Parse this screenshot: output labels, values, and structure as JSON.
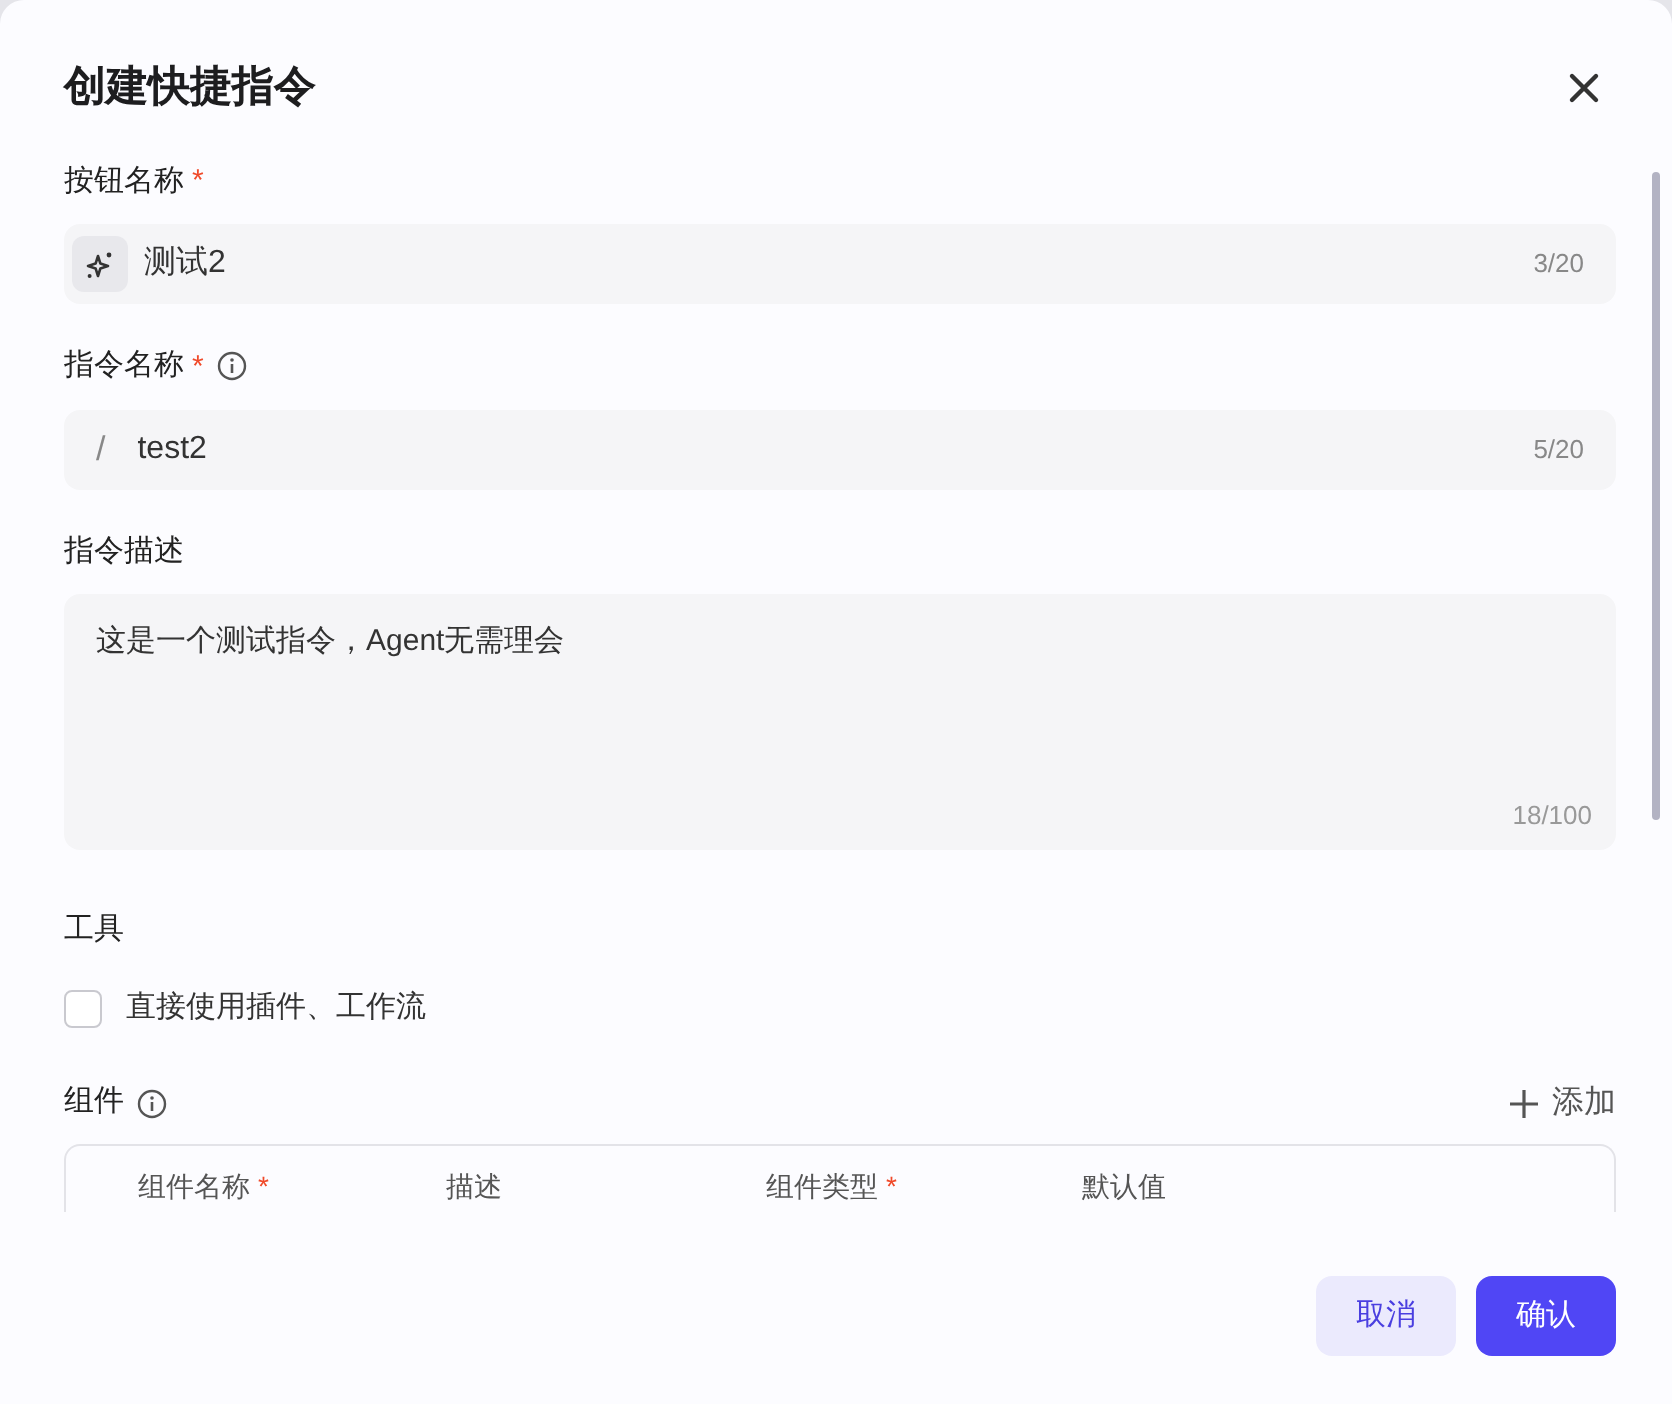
{
  "dialog": {
    "title": "创建快捷指令"
  },
  "fields": [
    {
      "kind": "icon-input",
      "label": "按钮名称",
      "mark": "*",
      "info": false,
      "value": "测试2",
      "counter": "3/20"
    },
    {
      "kind": "prefix-input",
      "label": "指令名称",
      "mark": "*",
      "info": true,
      "value": "test2",
      "prefix": "/",
      "counter": "5/20"
    },
    {
      "kind": "textarea",
      "label": "指令描述",
      "info": false,
      "value": "这是一个测试指令，Agent无需理会",
      "counter": "18/100"
    }
  ],
  "tools": {
    "label": "工具",
    "option": {
      "label": "直接使用插件、工作流",
      "checked": false
    }
  },
  "components": {
    "label": "组件",
    "add_label": "添加",
    "columns": [
      {
        "label": "组件名称",
        "mark": "*"
      },
      {
        "label": "描述"
      },
      {
        "label": "组件类型",
        "mark": "*"
      },
      {
        "label": "默认值"
      }
    ]
  },
  "buttons": [
    {
      "label": "取消",
      "kind": "secondary"
    },
    {
      "label": "确认",
      "kind": "primary"
    }
  ]
}
